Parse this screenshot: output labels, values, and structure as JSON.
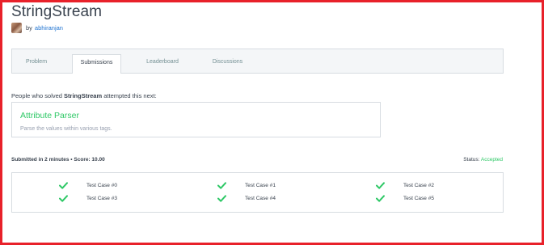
{
  "challenge": {
    "title": "StringStream",
    "by_label": "by",
    "author": "abhiranjan"
  },
  "tabs": [
    {
      "label": "Problem",
      "active": false
    },
    {
      "label": "Submissions",
      "active": true
    },
    {
      "label": "Leaderboard",
      "active": false
    },
    {
      "label": "Discussions",
      "active": false
    }
  ],
  "next": {
    "prefix": "People who solved ",
    "challenge": "StringStream",
    "suffix": " attempted this next:"
  },
  "suggestion": {
    "title": "Attribute Parser",
    "subtitle": "Parse the values within various tags."
  },
  "submission": {
    "summary": "Submitted in 2 minutes • Score: 10.00",
    "status_label": "Status:",
    "status_value": "Accepted"
  },
  "test_cases": [
    {
      "label": "Test Case #0",
      "passed": true
    },
    {
      "label": "Test Case #1",
      "passed": true
    },
    {
      "label": "Test Case #2",
      "passed": true
    },
    {
      "label": "Test Case #3",
      "passed": true
    },
    {
      "label": "Test Case #4",
      "passed": true
    },
    {
      "label": "Test Case #5",
      "passed": true
    }
  ],
  "colors": {
    "accent_green": "#2ec866",
    "link_blue": "#1f73d1",
    "frame_red": "#e8212a"
  },
  "icons": {
    "pass": "check-icon"
  }
}
